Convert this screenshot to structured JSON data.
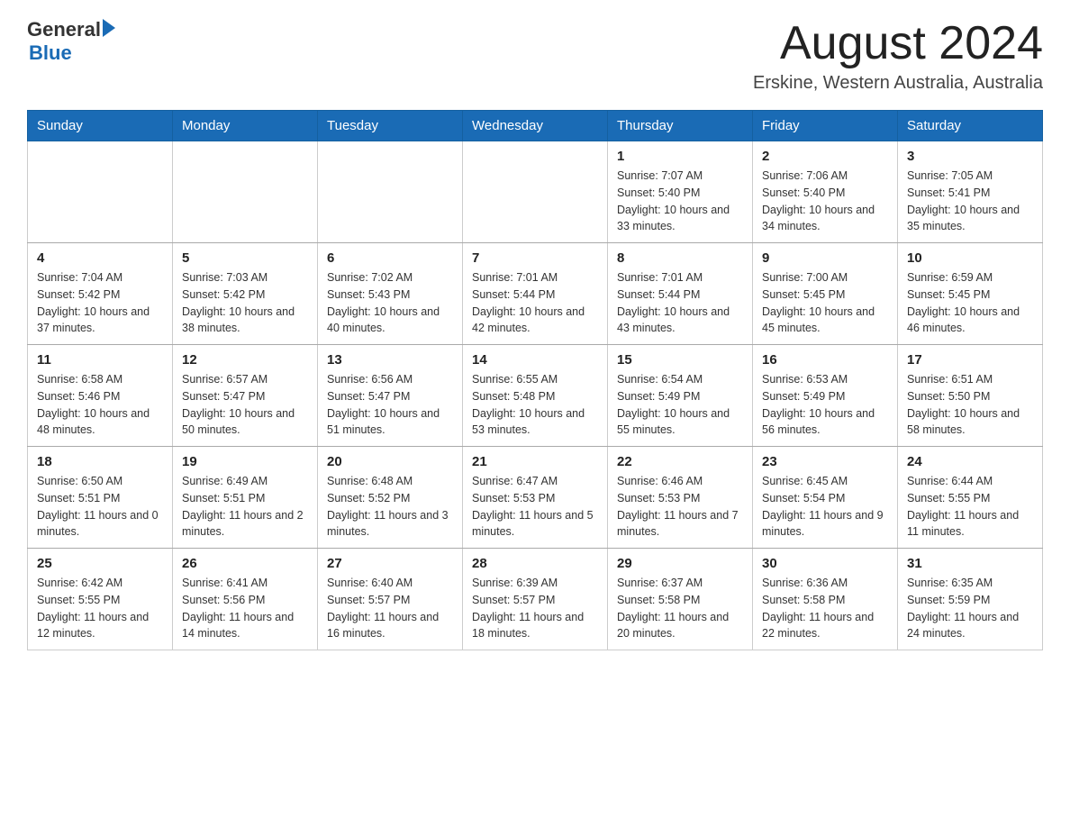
{
  "header": {
    "logo_general": "General",
    "logo_blue": "Blue",
    "title": "August 2024",
    "location": "Erskine, Western Australia, Australia"
  },
  "calendar": {
    "days_of_week": [
      "Sunday",
      "Monday",
      "Tuesday",
      "Wednesday",
      "Thursday",
      "Friday",
      "Saturday"
    ],
    "weeks": [
      [
        {
          "day": "",
          "sunrise": "",
          "sunset": "",
          "daylight": ""
        },
        {
          "day": "",
          "sunrise": "",
          "sunset": "",
          "daylight": ""
        },
        {
          "day": "",
          "sunrise": "",
          "sunset": "",
          "daylight": ""
        },
        {
          "day": "",
          "sunrise": "",
          "sunset": "",
          "daylight": ""
        },
        {
          "day": "1",
          "sunrise": "Sunrise: 7:07 AM",
          "sunset": "Sunset: 5:40 PM",
          "daylight": "Daylight: 10 hours and 33 minutes."
        },
        {
          "day": "2",
          "sunrise": "Sunrise: 7:06 AM",
          "sunset": "Sunset: 5:40 PM",
          "daylight": "Daylight: 10 hours and 34 minutes."
        },
        {
          "day": "3",
          "sunrise": "Sunrise: 7:05 AM",
          "sunset": "Sunset: 5:41 PM",
          "daylight": "Daylight: 10 hours and 35 minutes."
        }
      ],
      [
        {
          "day": "4",
          "sunrise": "Sunrise: 7:04 AM",
          "sunset": "Sunset: 5:42 PM",
          "daylight": "Daylight: 10 hours and 37 minutes."
        },
        {
          "day": "5",
          "sunrise": "Sunrise: 7:03 AM",
          "sunset": "Sunset: 5:42 PM",
          "daylight": "Daylight: 10 hours and 38 minutes."
        },
        {
          "day": "6",
          "sunrise": "Sunrise: 7:02 AM",
          "sunset": "Sunset: 5:43 PM",
          "daylight": "Daylight: 10 hours and 40 minutes."
        },
        {
          "day": "7",
          "sunrise": "Sunrise: 7:01 AM",
          "sunset": "Sunset: 5:44 PM",
          "daylight": "Daylight: 10 hours and 42 minutes."
        },
        {
          "day": "8",
          "sunrise": "Sunrise: 7:01 AM",
          "sunset": "Sunset: 5:44 PM",
          "daylight": "Daylight: 10 hours and 43 minutes."
        },
        {
          "day": "9",
          "sunrise": "Sunrise: 7:00 AM",
          "sunset": "Sunset: 5:45 PM",
          "daylight": "Daylight: 10 hours and 45 minutes."
        },
        {
          "day": "10",
          "sunrise": "Sunrise: 6:59 AM",
          "sunset": "Sunset: 5:45 PM",
          "daylight": "Daylight: 10 hours and 46 minutes."
        }
      ],
      [
        {
          "day": "11",
          "sunrise": "Sunrise: 6:58 AM",
          "sunset": "Sunset: 5:46 PM",
          "daylight": "Daylight: 10 hours and 48 minutes."
        },
        {
          "day": "12",
          "sunrise": "Sunrise: 6:57 AM",
          "sunset": "Sunset: 5:47 PM",
          "daylight": "Daylight: 10 hours and 50 minutes."
        },
        {
          "day": "13",
          "sunrise": "Sunrise: 6:56 AM",
          "sunset": "Sunset: 5:47 PM",
          "daylight": "Daylight: 10 hours and 51 minutes."
        },
        {
          "day": "14",
          "sunrise": "Sunrise: 6:55 AM",
          "sunset": "Sunset: 5:48 PM",
          "daylight": "Daylight: 10 hours and 53 minutes."
        },
        {
          "day": "15",
          "sunrise": "Sunrise: 6:54 AM",
          "sunset": "Sunset: 5:49 PM",
          "daylight": "Daylight: 10 hours and 55 minutes."
        },
        {
          "day": "16",
          "sunrise": "Sunrise: 6:53 AM",
          "sunset": "Sunset: 5:49 PM",
          "daylight": "Daylight: 10 hours and 56 minutes."
        },
        {
          "day": "17",
          "sunrise": "Sunrise: 6:51 AM",
          "sunset": "Sunset: 5:50 PM",
          "daylight": "Daylight: 10 hours and 58 minutes."
        }
      ],
      [
        {
          "day": "18",
          "sunrise": "Sunrise: 6:50 AM",
          "sunset": "Sunset: 5:51 PM",
          "daylight": "Daylight: 11 hours and 0 minutes."
        },
        {
          "day": "19",
          "sunrise": "Sunrise: 6:49 AM",
          "sunset": "Sunset: 5:51 PM",
          "daylight": "Daylight: 11 hours and 2 minutes."
        },
        {
          "day": "20",
          "sunrise": "Sunrise: 6:48 AM",
          "sunset": "Sunset: 5:52 PM",
          "daylight": "Daylight: 11 hours and 3 minutes."
        },
        {
          "day": "21",
          "sunrise": "Sunrise: 6:47 AM",
          "sunset": "Sunset: 5:53 PM",
          "daylight": "Daylight: 11 hours and 5 minutes."
        },
        {
          "day": "22",
          "sunrise": "Sunrise: 6:46 AM",
          "sunset": "Sunset: 5:53 PM",
          "daylight": "Daylight: 11 hours and 7 minutes."
        },
        {
          "day": "23",
          "sunrise": "Sunrise: 6:45 AM",
          "sunset": "Sunset: 5:54 PM",
          "daylight": "Daylight: 11 hours and 9 minutes."
        },
        {
          "day": "24",
          "sunrise": "Sunrise: 6:44 AM",
          "sunset": "Sunset: 5:55 PM",
          "daylight": "Daylight: 11 hours and 11 minutes."
        }
      ],
      [
        {
          "day": "25",
          "sunrise": "Sunrise: 6:42 AM",
          "sunset": "Sunset: 5:55 PM",
          "daylight": "Daylight: 11 hours and 12 minutes."
        },
        {
          "day": "26",
          "sunrise": "Sunrise: 6:41 AM",
          "sunset": "Sunset: 5:56 PM",
          "daylight": "Daylight: 11 hours and 14 minutes."
        },
        {
          "day": "27",
          "sunrise": "Sunrise: 6:40 AM",
          "sunset": "Sunset: 5:57 PM",
          "daylight": "Daylight: 11 hours and 16 minutes."
        },
        {
          "day": "28",
          "sunrise": "Sunrise: 6:39 AM",
          "sunset": "Sunset: 5:57 PM",
          "daylight": "Daylight: 11 hours and 18 minutes."
        },
        {
          "day": "29",
          "sunrise": "Sunrise: 6:37 AM",
          "sunset": "Sunset: 5:58 PM",
          "daylight": "Daylight: 11 hours and 20 minutes."
        },
        {
          "day": "30",
          "sunrise": "Sunrise: 6:36 AM",
          "sunset": "Sunset: 5:58 PM",
          "daylight": "Daylight: 11 hours and 22 minutes."
        },
        {
          "day": "31",
          "sunrise": "Sunrise: 6:35 AM",
          "sunset": "Sunset: 5:59 PM",
          "daylight": "Daylight: 11 hours and 24 minutes."
        }
      ]
    ]
  }
}
